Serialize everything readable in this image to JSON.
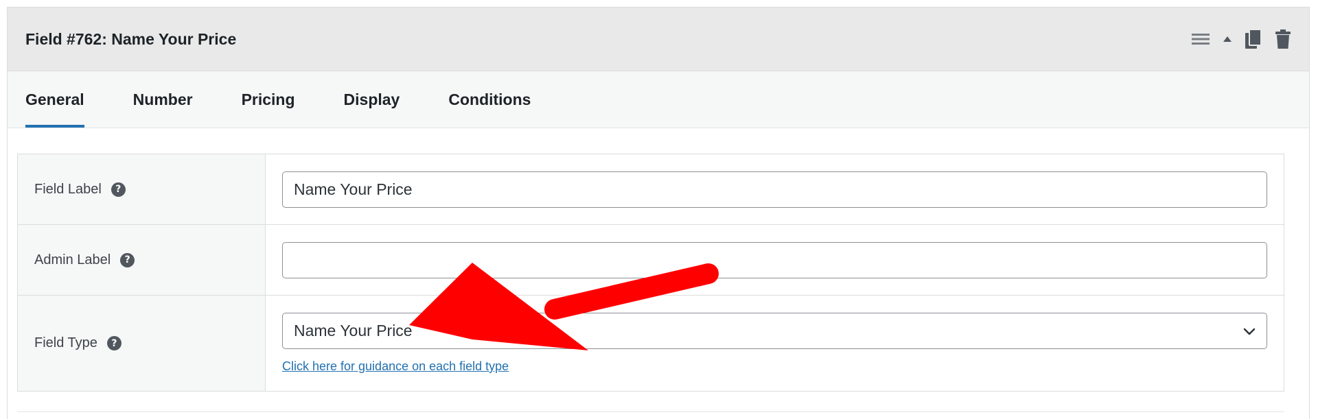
{
  "header": {
    "title": "Field #762: Name Your Price",
    "actions": [
      "menu-icon",
      "caret-up-icon",
      "duplicate-icon",
      "trash-icon"
    ]
  },
  "tabs": [
    {
      "label": "General",
      "active": true
    },
    {
      "label": "Number",
      "active": false
    },
    {
      "label": "Pricing",
      "active": false
    },
    {
      "label": "Display",
      "active": false
    },
    {
      "label": "Conditions",
      "active": false
    }
  ],
  "form": {
    "field_label": {
      "label": "Field Label",
      "value": "Name Your Price"
    },
    "admin_label": {
      "label": "Admin Label",
      "value": ""
    },
    "field_type": {
      "label": "Field Type",
      "selected": "Name Your Price",
      "help_link": "Click here for guidance on each field type"
    }
  },
  "colors": {
    "accent": "#2271b1",
    "annotation_arrow": "#ff0000"
  }
}
